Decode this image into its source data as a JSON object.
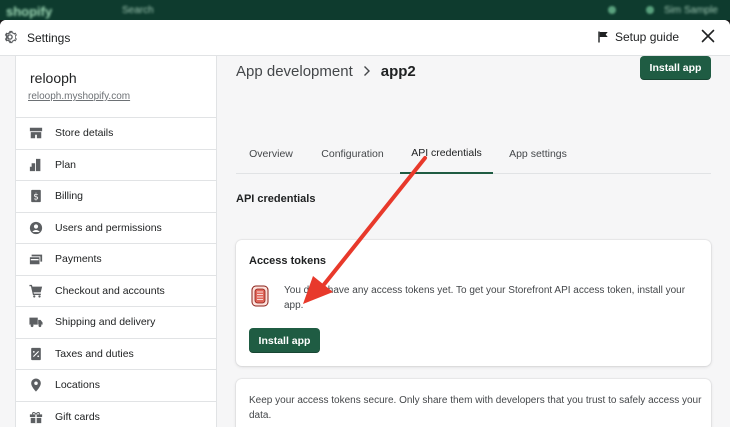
{
  "backdrop": {
    "logo": "shopify",
    "search": "Search",
    "user": "Sim Sample"
  },
  "window": {
    "title": "Settings",
    "setup_guide": "Setup guide"
  },
  "sidebar": {
    "store_name": "relooph",
    "store_url": "relooph.myshopify.com",
    "items": [
      {
        "label": "Store details",
        "icon": "store-icon"
      },
      {
        "label": "Plan",
        "icon": "plan-icon"
      },
      {
        "label": "Billing",
        "icon": "billing-icon"
      },
      {
        "label": "Users and permissions",
        "icon": "user-icon"
      },
      {
        "label": "Payments",
        "icon": "payments-icon"
      },
      {
        "label": "Checkout and accounts",
        "icon": "cart-icon"
      },
      {
        "label": "Shipping and delivery",
        "icon": "truck-icon"
      },
      {
        "label": "Taxes and duties",
        "icon": "tax-icon"
      },
      {
        "label": "Locations",
        "icon": "location-icon"
      },
      {
        "label": "Gift cards",
        "icon": "gift-icon"
      }
    ]
  },
  "main": {
    "breadcrumb_parent": "App development",
    "breadcrumb_current": "app2",
    "install_button": "Install app",
    "tabs": [
      {
        "label": "Overview"
      },
      {
        "label": "Configuration"
      },
      {
        "label": "API credentials",
        "active": true
      },
      {
        "label": "App settings"
      }
    ],
    "section_title": "API credentials",
    "access_card": {
      "title": "Access tokens",
      "message": "You don't have any access tokens yet. To get your Storefront API access token, install your app.",
      "button": "Install app"
    },
    "security_card": {
      "message": "Keep your access tokens secure. Only share them with developers that you trust to safely access your data."
    }
  },
  "colors": {
    "primary": "#1f5c43",
    "annotation": "#e8392b"
  }
}
